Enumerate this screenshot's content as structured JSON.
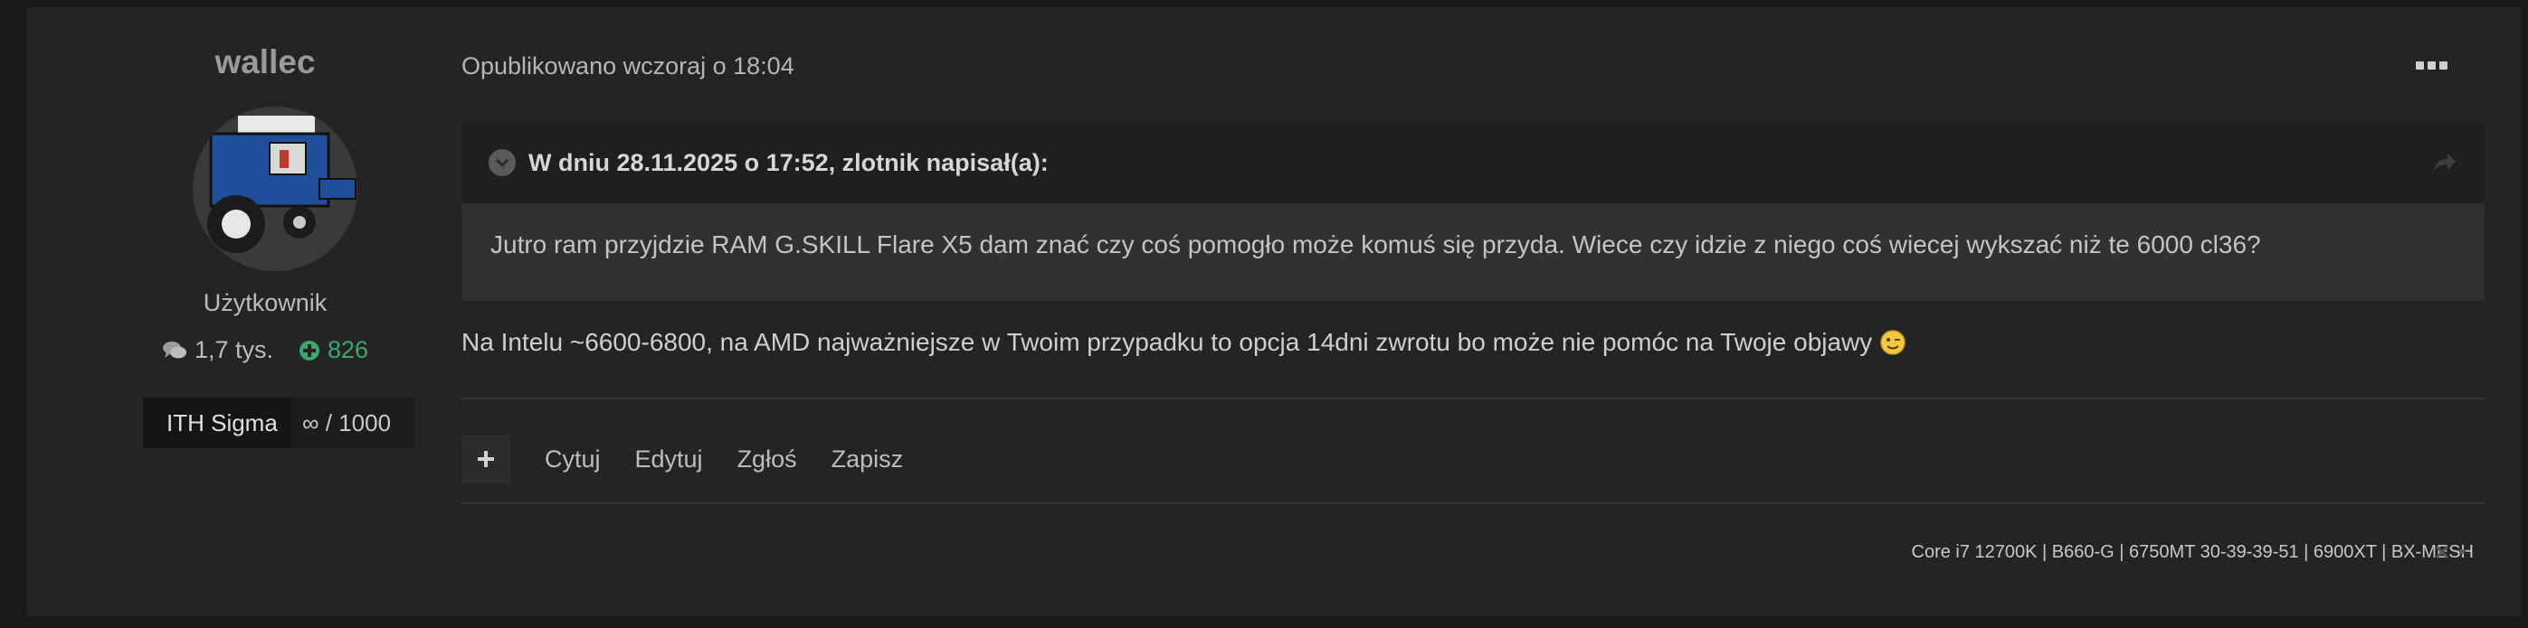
{
  "author": {
    "name": "wallec",
    "rank": "Użytkownik",
    "posts": "1,7 tys.",
    "reputation": "826",
    "badge_name": "ITH Sigma",
    "badge_value": "∞ / 1000"
  },
  "post": {
    "timestamp": "Opublikowano wczoraj o 18:04",
    "quote_header": "W dniu 28.11.2025 o 17:52, zlotnik napisał(a):",
    "quote_text": "Jutro ram przyjdzie RAM G.SKILL Flare X5 dam znać czy coś pomogło może komuś się przyda. Wiece czy idzie z niego coś wiecej wykszać niż te 6000 cl36?",
    "body_text": "Na Intelu ~6600-6800, na AMD najważniejsze w Twoim przypadku to opcja 14dni zwrotu bo może nie pomóc na Twoje objawy",
    "emoji": "wink-emoji"
  },
  "actions": {
    "quote": "Cytuj",
    "edit": "Edytuj",
    "report": "Zgłoś",
    "save": "Zapisz"
  },
  "signature": "Core i7 12700K | B660-G | 6750MT 30-39-39-51 | 6900XT | BX-MESH",
  "icons": {
    "more": "ellipsis-icon",
    "toggle": "chevron-down-icon",
    "share": "share-arrow-icon",
    "add": "plus-icon",
    "posts": "comments-icon",
    "rep": "plus-circle-icon",
    "close": "close-icon",
    "caret": "caret-down-icon"
  },
  "colors": {
    "background": "#242424",
    "reputation": "#3aa76d",
    "quote_bg": "#313131"
  }
}
